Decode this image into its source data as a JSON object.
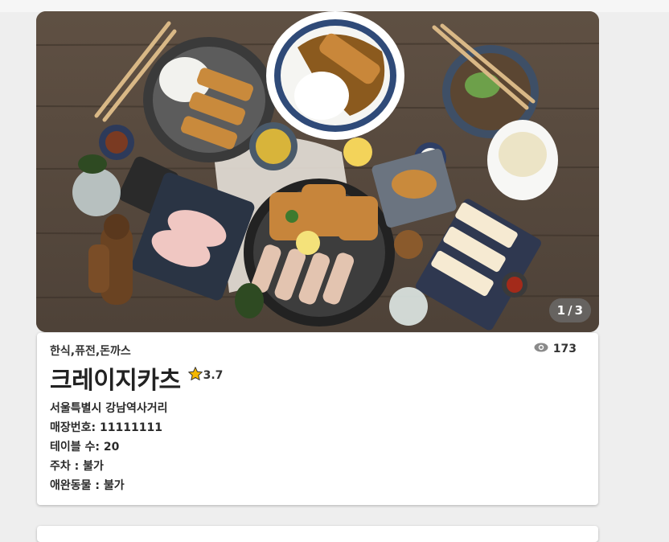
{
  "gallery": {
    "current": "1",
    "separator": "/",
    "total": "3"
  },
  "restaurant": {
    "categories": "한식,퓨전,돈까스",
    "name": "크레이지카츠",
    "rating": "3.7",
    "views": "173",
    "address": "서울특별시 강남역사거리",
    "phone_label": "매장번호:",
    "phone": "11111111",
    "tables_label": "테이블 수:",
    "tables": "20",
    "parking_label": "주차 :",
    "parking": "불가",
    "pets_label": "애완동물 :",
    "pets": "불가"
  },
  "icons": {
    "views": "eye-icon",
    "rating": "star-icon"
  },
  "colors": {
    "star": "#f5b800",
    "eye": "#8a8a8a"
  }
}
